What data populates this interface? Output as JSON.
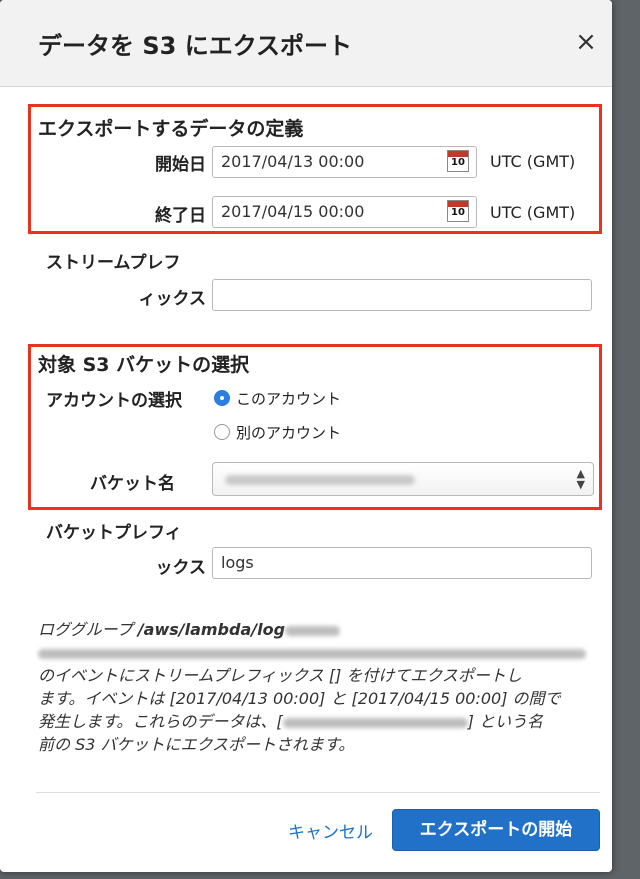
{
  "dialog": {
    "title": "データを S3 にエクスポート",
    "close_glyph": "×"
  },
  "define_section": {
    "title": "エクスポートするデータの定義",
    "start_label": "開始日",
    "start_value": "2017/04/13 00:00",
    "end_label": "終了日",
    "end_value": "2017/04/15 00:00",
    "calendar_day": "10",
    "timezone": "UTC (GMT)"
  },
  "stream_prefix": {
    "label_line1": "ストリームプレフ",
    "label_line2": "ィックス",
    "value": ""
  },
  "bucket_section": {
    "title": "対象 S3 バケットの選択",
    "account_label": "アカウントの選択",
    "option_this": "このアカウント",
    "option_other": "別のアカウント",
    "selected": "this",
    "bucket_label": "バケット名"
  },
  "bucket_prefix": {
    "label_line1": "バケットプレフィ",
    "label_line2": "ックス",
    "value": "logs"
  },
  "description": {
    "line1_prefix": "ロググループ ",
    "log_group": "/aws/lambda/log",
    "line3": "のイベントにストリームプレフィックス [] を付けてエクスポートし",
    "line4": "ます。イベントは [2017/04/13 00:00] と [2017/04/15 00:00] の間で",
    "line5_prefix": "発生します。これらのデータは、[",
    "line5_suffix": "] という名",
    "line6": "前の S3 バケットにエクスポートされます。"
  },
  "footer": {
    "cancel_label": "キャンセル",
    "start_export_label": "エクスポートの開始"
  },
  "colors": {
    "highlight_border": "#e8331f",
    "primary": "#2271c8",
    "link": "#1a73c9"
  }
}
